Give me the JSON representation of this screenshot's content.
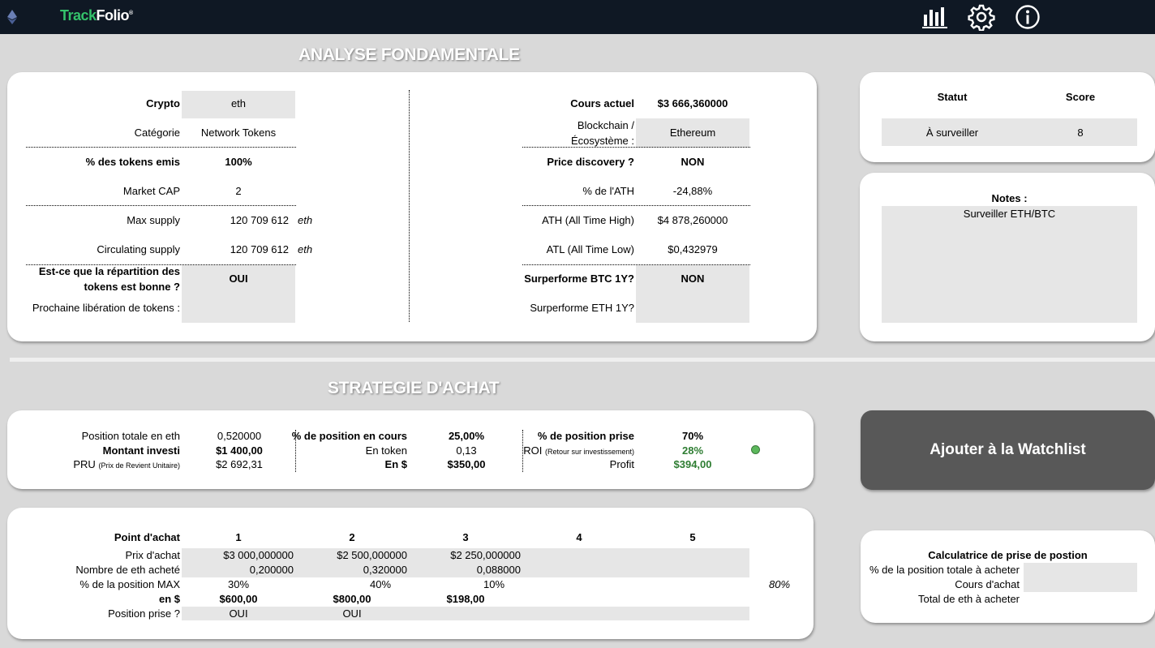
{
  "app": {
    "logo_part1": "Track",
    "logo_part2": "Folio",
    "logo_mark": "®",
    "icons": [
      "eth-diamond-icon",
      "bar-chart-icon",
      "gear-icon",
      "info-icon"
    ],
    "colors": {
      "topbar": "#0f1824",
      "logo_green": "#34c26b",
      "positive": "#2e7d32",
      "button": "#585858",
      "status_dot": "#5cb85c"
    }
  },
  "fundamental": {
    "title": "ANALYSE FONDAMENTALE",
    "left": {
      "crypto_label": "Crypto",
      "crypto_value": "eth",
      "category_label": "Catégorie",
      "category_value": "Network Tokens",
      "tokens_emitted_label": "% des tokens emis",
      "tokens_emitted_value": "100%",
      "market_cap_label": "Market CAP",
      "market_cap_value": "2",
      "max_supply_label": "Max supply",
      "max_supply_value": "120 709 612",
      "max_supply_unit": "eth",
      "circ_supply_label": "Circulating supply",
      "circ_supply_value": "120 709 612",
      "circ_supply_unit": "eth",
      "distribution_label_1": "Est-ce que la répartition des",
      "distribution_label_2": "tokens est bonne ?",
      "distribution_value": "OUI",
      "next_release_label": "Prochaine libération de tokens :",
      "next_release_value": ""
    },
    "right": {
      "price_label": "Cours actuel",
      "price_value": "$3 666,360000",
      "blockchain_label_1": "Blockchain /",
      "blockchain_label_2": "Écosystème :",
      "blockchain_value": "Ethereum",
      "price_discovery_label": "Price discovery ?",
      "price_discovery_value": "NON",
      "pct_ath_label": "% de l'ATH",
      "pct_ath_value": "-24,88%",
      "ath_label": "ATH (All Time High)",
      "ath_value": "$4 878,260000",
      "atl_label": "ATL (All Time Low)",
      "atl_value": "$0,432979",
      "outperf_btc_label": "Surperforme BTC  1Y?",
      "outperf_btc_value": "NON",
      "outperf_eth_label": "Surperforme ETH 1Y?",
      "outperf_eth_value": ""
    }
  },
  "status_panel": {
    "status_header": "Statut",
    "score_header": "Score",
    "status_value": "À surveiller",
    "score_value": "8"
  },
  "notes_panel": {
    "label": "Notes :",
    "content": "Surveiller ETH/BTC"
  },
  "strategy": {
    "title": "STRATEGIE D'ACHAT",
    "summary": {
      "total_position_label": "Position totale en eth",
      "total_position_value": "0,520000",
      "invested_label": "Montant investi",
      "invested_value": "$1 400,00",
      "pru_label": "PRU",
      "pru_note": "(Prix de Revient Unitaire)",
      "pru_value": "$2 692,31",
      "current_pos_label": "% de position en cours",
      "current_pos_value": "25,00%",
      "in_token_label": "En token",
      "in_token_value": "0,13",
      "in_usd_label": "En $",
      "in_usd_value": "$350,00",
      "taken_pos_label": "% de position prise",
      "taken_pos_value": "70%",
      "roi_label": "ROI",
      "roi_note": "(Retour sur investissement)",
      "roi_value": "28%",
      "profit_label": "Profit",
      "profit_value": "$394,00"
    },
    "watchlist_button": "Ajouter à la Watchlist",
    "buy_points": {
      "header_label": "Point d'achat",
      "columns": [
        "1",
        "2",
        "3",
        "4",
        "5"
      ],
      "price_label": "Prix d'achat",
      "prices": [
        "$3 000,000000",
        "$2 500,000000",
        "$2 250,000000",
        "",
        ""
      ],
      "qty_label": "Nombre de eth acheté",
      "qtys": [
        "0,200000",
        "0,320000",
        "0,088000",
        "",
        ""
      ],
      "pct_label": "% de la position MAX",
      "pcts": [
        "30%",
        "40%",
        "10%",
        "",
        ""
      ],
      "pct_total": "80%",
      "usd_label": "en $",
      "usds": [
        "$600,00",
        "$800,00",
        "$198,00",
        "",
        ""
      ],
      "taken_label": "Position prise ?",
      "takens": [
        "OUI",
        "OUI",
        "",
        "",
        ""
      ]
    },
    "calculator": {
      "title": "Calculatrice de prise de postion",
      "pct_label": "% de la position totale à acheter",
      "price_label": "Cours d'achat",
      "total_label": "Total de eth à acheter"
    }
  }
}
